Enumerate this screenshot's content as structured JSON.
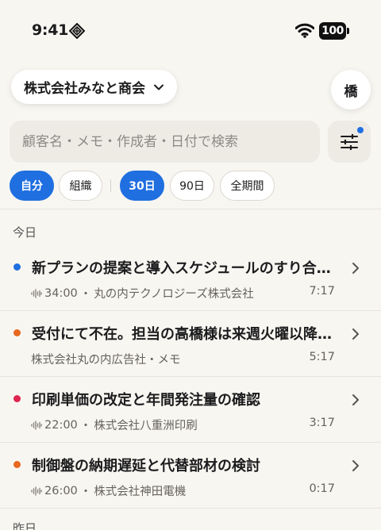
{
  "status": {
    "time": "9:41",
    "battery": "100"
  },
  "header": {
    "company": "株式会社みなと商会",
    "avatar": "橋"
  },
  "search": {
    "placeholder": "顧客名・メモ・作成者・日付で検索"
  },
  "chips": [
    {
      "label": "自分",
      "active": true
    },
    {
      "label": "組織",
      "active": false
    },
    {
      "label": "30日",
      "active": true
    },
    {
      "label": "90日",
      "active": false
    },
    {
      "label": "全期間",
      "active": false
    }
  ],
  "sections": {
    "today": "今日",
    "yesterday": "昨日"
  },
  "items": [
    {
      "title": "新プランの提案と導入スケジュールのすり合わせ",
      "recording": "34:00",
      "customer": "丸の内テクノロジーズ株式会社",
      "duration": "7:17",
      "dot_color": "#1f6fe0",
      "has_audio": true
    },
    {
      "title": "受付にて不在。担当の高橋様は来週火曜以降に再訪",
      "recording": "",
      "customer": "株式会社丸の内広告社・メモ",
      "duration": "5:17",
      "dot_color": "#e8681f",
      "has_audio": false
    },
    {
      "title": "印刷単価の改定と年間発注量の確認",
      "recording": "22:00",
      "customer": "株式会社八重洲印刷",
      "duration": "3:17",
      "dot_color": "#e0234f",
      "has_audio": true
    },
    {
      "title": "制御盤の納期遅延と代替部材の検討",
      "recording": "26:00",
      "customer": "株式会社神田電機",
      "duration": "0:17",
      "dot_color": "#e8681f",
      "has_audio": true
    }
  ],
  "colors": {
    "accent": "#1f6fe0",
    "background": "#f8f6f1"
  }
}
